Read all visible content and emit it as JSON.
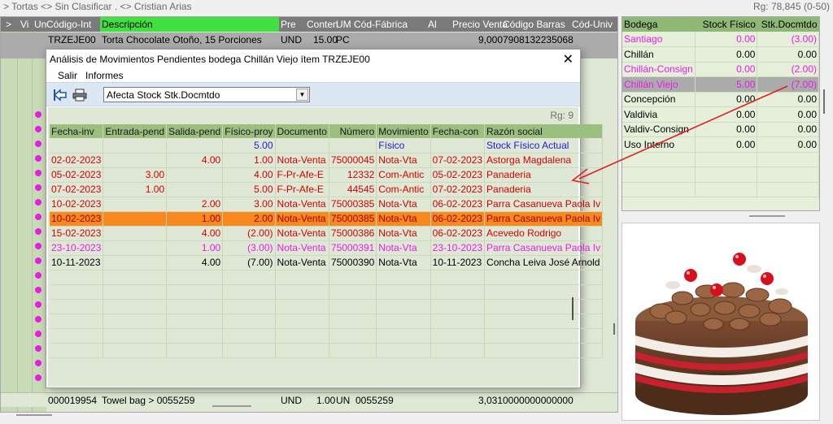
{
  "breadcrumb": "> Tortas <> Sin Clasificar . <> Cristian Arias",
  "record_count": "Rg: 78,845 (0-50)",
  "main_grid": {
    "headers": [
      ">",
      "Vi",
      "Un",
      "Código-Int",
      "Descripción",
      "Pre",
      "Conten",
      "UM",
      "Cód-Fábrica",
      "Al",
      "Precio Venta",
      "Código Barras",
      "Cód-Univ"
    ],
    "first_row": {
      "code": "TRZEJE00",
      "description": "Torta Chocolate Otoño, 15 Porciones",
      "pre": "UND",
      "content": "15.00",
      "um": "PC",
      "price": "9,000",
      "barcode": "7908132235068"
    },
    "last_row": {
      "code": "000019954",
      "description": "Towel bag > 0055259",
      "pre": "UND",
      "content": "1.00",
      "um": "UN",
      "factory": "0055259",
      "price": "3,031",
      "barcode": "0000000000000"
    }
  },
  "modal": {
    "title": "Análisis de Movimientos Pendientes bodega Chillán Viejo ítem TRZEJE00",
    "close": "✕",
    "menu": [
      "Salir",
      "Informes"
    ],
    "filter_value": "Afecta Stock Stk.Docmtdo",
    "rg": "Rg: 9",
    "columns": [
      "Fecha-inv",
      "Entrada-pend",
      "Salida-pend",
      "Físico-proy",
      "Documento",
      "Número",
      "Movimiento",
      "Fecha-con",
      "Razón social"
    ],
    "rows": [
      {
        "style": "blue",
        "cells": [
          "",
          "",
          "",
          "5.00",
          "",
          "",
          "Físico",
          "",
          "Stock Físico Actual"
        ]
      },
      {
        "style": "red",
        "cells": [
          "02-02-2023",
          "",
          "4.00",
          "1.00",
          "Nota-Venta",
          "75000045",
          "Nota-Vta",
          "07-02-2023",
          "Astorga Magdalena"
        ]
      },
      {
        "style": "red",
        "cells": [
          "05-02-2023",
          "3.00",
          "",
          "4.00",
          "F-Pr-Afe-E",
          "12332",
          "Com-Antic",
          "05-02-2023",
          "Panaderia"
        ]
      },
      {
        "style": "red",
        "cells": [
          "07-02-2023",
          "1.00",
          "",
          "5.00",
          "F-Pr-Afe-E",
          "44545",
          "Com-Antic",
          "07-02-2023",
          "Panaderia"
        ]
      },
      {
        "style": "red",
        "cells": [
          "10-02-2023",
          "",
          "2.00",
          "3.00",
          "Nota-Venta",
          "75000385",
          "Nota-Vta",
          "06-02-2023",
          "Parra Casanueva Paola Iv"
        ]
      },
      {
        "style": "sel",
        "cells": [
          "10-02-2023",
          "",
          "1.00",
          "2.00",
          "Nota-Venta",
          "75000385",
          "Nota-Vta",
          "06-02-2023",
          "Parra Casanueva Paola Iv"
        ]
      },
      {
        "style": "red",
        "cells": [
          "15-02-2023",
          "",
          "4.00",
          "(2.00)",
          "Nota-Venta",
          "75000386",
          "Nota-Vta",
          "06-02-2023",
          "Acevedo Rodrigo"
        ]
      },
      {
        "style": "pink",
        "cells": [
          "23-10-2023",
          "",
          "1.00",
          "(3.00)",
          "Nota-Venta",
          "75000391",
          "Nota-Vta",
          "23-10-2023",
          "Parra Casanueva Paola Iv"
        ]
      },
      {
        "style": "blk",
        "cells": [
          "10-11-2023",
          "",
          "4.00",
          "(7.00)",
          "Nota-Venta",
          "75000390",
          "Nota-Vta",
          "10-11-2023",
          "Concha Leiva José Arnold"
        ]
      }
    ]
  },
  "bodega_panel": {
    "columns": [
      "Bodega",
      "Stock Físico",
      "Stk.Docmtdo"
    ],
    "rows": [
      {
        "style": "bdpink",
        "cells": [
          "Santiago",
          "0.00",
          "(3.00)"
        ]
      },
      {
        "style": "plain",
        "cells": [
          "Chillán",
          "0.00",
          "0.00"
        ]
      },
      {
        "style": "bdpink",
        "cells": [
          "Chillán-Consign",
          "0.00",
          "(2.00)"
        ]
      },
      {
        "style": "bdsel",
        "cells": [
          "Chillán Viejo",
          "5.00",
          "(7.00)"
        ]
      },
      {
        "style": "plain",
        "cells": [
          "Concepción",
          "0.00",
          "0.00"
        ]
      },
      {
        "style": "plain",
        "cells": [
          "Valdivia",
          "0.00",
          "0.00"
        ]
      },
      {
        "style": "plain",
        "cells": [
          "Valdiv-Consign",
          "0.00",
          "0.00"
        ]
      },
      {
        "style": "plain",
        "cells": [
          "Uso Interno",
          "0.00",
          "0.00"
        ]
      }
    ]
  },
  "icons": {
    "back": "back-arrow-icon",
    "print": "printer-icon",
    "close": "close-icon",
    "dropdown": "chevron-down-icon"
  },
  "colors": {
    "grid_bg": "#dfe8d4",
    "header_green": "#9bbf7e",
    "selected_row": "#f7891e",
    "pink_text": "#e81ce8",
    "red_text": "#d40000",
    "annotation_arrow": "#e02020"
  }
}
